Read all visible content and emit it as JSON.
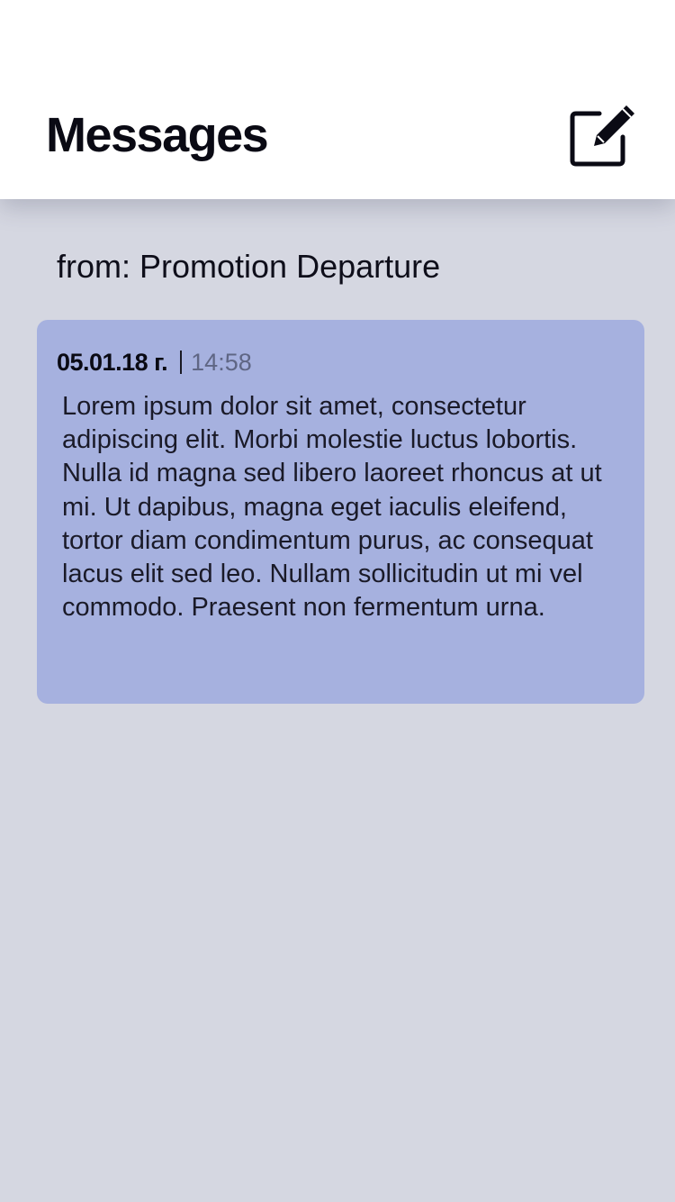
{
  "header": {
    "title": "Messages",
    "compose_icon": "compose-icon"
  },
  "message": {
    "from": "from: Promotion Departure",
    "date": "05.01.18 г.",
    "time": "14:58",
    "body": "Lorem ipsum dolor sit amet, consectetur adipiscing elit. Morbi molestie luctus lobortis. Nulla id magna sed libero laoreet rhoncus at ut mi. Ut dapibus, magna eget iaculis eleifend, tortor diam condimentum purus, ac consequat lacus elit sed leo. Nullam sollicitudin ut mi vel commodo. Praesent non fermentum urna."
  },
  "colors": {
    "background": "#d5d7e1",
    "header": "#ffffff",
    "card": "#a6b1df",
    "time": "#5f6684"
  }
}
